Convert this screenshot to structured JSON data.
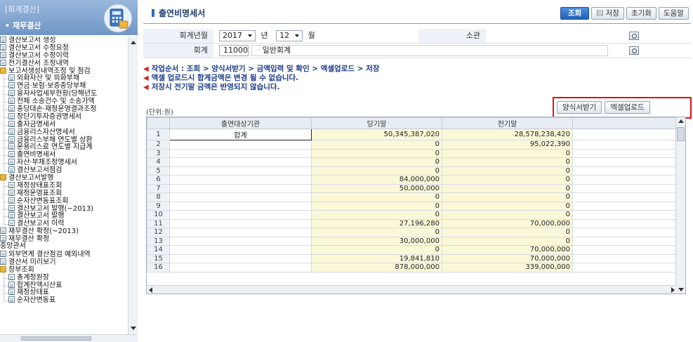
{
  "sidebar": {
    "bracket_title": "[회계결산]",
    "section_title": "재무결산",
    "items": [
      {
        "label": "결산보고서 생성",
        "type": "doc",
        "level": 0
      },
      {
        "label": "결산보고서 수정요청",
        "type": "doc",
        "level": 0
      },
      {
        "label": "결산보고서 수정이력",
        "type": "doc",
        "level": 0
      },
      {
        "label": "전기결산서 조정내역",
        "type": "doc",
        "level": 0
      },
      {
        "label": "보고서생성내역조정 및 점검",
        "type": "folder",
        "level": 0
      },
      {
        "label": "외화자산 및 외화부채",
        "type": "doc",
        "level": 1
      },
      {
        "label": "연금·보험·보증충당부채",
        "type": "doc",
        "level": 1
      },
      {
        "label": "융자사업세부현황(당해년도",
        "type": "doc",
        "level": 1
      },
      {
        "label": "전체 소송건수 및 소송가액",
        "type": "doc",
        "level": 1
      },
      {
        "label": "충당대손·재정운영결과조정",
        "type": "doc",
        "level": 1
      },
      {
        "label": "장단기투자증권명세서",
        "type": "doc",
        "level": 1
      },
      {
        "label": "출자금명세서",
        "type": "doc",
        "level": 1
      },
      {
        "label": "금융리스자산명세서",
        "type": "doc",
        "level": 1
      },
      {
        "label": "금융리스부채 연도별 상환",
        "type": "doc",
        "level": 1
      },
      {
        "label": "운용리스료 연도별 지급계",
        "type": "doc",
        "level": 1
      },
      {
        "label": "출연비명세서",
        "type": "doc",
        "level": 1
      },
      {
        "label": "자산·부채조정명세서",
        "type": "doc",
        "level": 1
      },
      {
        "label": "결산보고서점검",
        "type": "doc",
        "level": 1
      },
      {
        "label": "결산보고서발행",
        "type": "folder",
        "level": 0
      },
      {
        "label": "재정상태표조회",
        "type": "doc",
        "level": 1
      },
      {
        "label": "재정운영표조회",
        "type": "doc",
        "level": 1
      },
      {
        "label": "순자산변동표조회",
        "type": "doc",
        "level": 1
      },
      {
        "label": "결산보고서 발행(~2013)",
        "type": "doc",
        "level": 1
      },
      {
        "label": "결산보고서 발행",
        "type": "doc",
        "level": 1
      },
      {
        "label": "결산보고서 이력",
        "type": "doc",
        "level": 1
      },
      {
        "label": "재무결산 확정(~2013)",
        "type": "doc",
        "level": 0
      },
      {
        "label": "재무결산 확정",
        "type": "doc",
        "level": 0
      },
      {
        "label": "중앙관서",
        "type": "none",
        "level": 0
      },
      {
        "label": "외부연계 결산점검 예외내역",
        "type": "doc",
        "level": 0
      },
      {
        "label": "결산서 미리보기",
        "type": "doc",
        "level": 0
      },
      {
        "label": "장부조회",
        "type": "folder",
        "level": 0
      },
      {
        "label": "총계정원장",
        "type": "doc",
        "level": 1
      },
      {
        "label": "합계잔액시산표",
        "type": "doc",
        "level": 1
      },
      {
        "label": "재정상태표",
        "type": "doc",
        "level": 1
      },
      {
        "label": "순자산변동표",
        "type": "doc",
        "level": 1
      }
    ]
  },
  "header": {
    "page_title": "출연비명세서",
    "buttons": {
      "search": "조회",
      "save": "저장",
      "reset": "초기화",
      "help": "도움말"
    }
  },
  "form": {
    "fiscal_label": "회계년월",
    "year": "2017",
    "year_unit": "년",
    "month": "12",
    "month_unit": "월",
    "office_label": "소관",
    "office_value": "",
    "account_label": "회계",
    "account_code": "11000",
    "account_name": "일반회계"
  },
  "notes": [
    "작업순서 : 조회 > 양식서받기 > 금액입력 및 확인 > 엑셀업로드 > 저장",
    "엑셀 업로드시 합계금액은 변경 될 수 없습니다.",
    "저장시 전기말 금액은 반영되지 않습니다."
  ],
  "unit_label": "(단위:원)",
  "upload_buttons": {
    "template": "양식서받기",
    "excel": "엑셀업로드"
  },
  "grid": {
    "columns": [
      "",
      "출연대상기관",
      "당기말",
      "전기말",
      ""
    ],
    "rows": [
      {
        "no": "1",
        "org": "합계",
        "current": "50,345,387,020",
        "previous": "28,578,238,420"
      },
      {
        "no": "2",
        "org": "",
        "current": "0",
        "previous": "95,022,390"
      },
      {
        "no": "3",
        "org": "",
        "current": "0",
        "previous": "0"
      },
      {
        "no": "4",
        "org": "",
        "current": "0",
        "previous": "0"
      },
      {
        "no": "5",
        "org": "",
        "current": "0",
        "previous": "0"
      },
      {
        "no": "6",
        "org": "",
        "current": "84,000,000",
        "previous": "0"
      },
      {
        "no": "7",
        "org": "",
        "current": "50,000,000",
        "previous": "0"
      },
      {
        "no": "8",
        "org": "",
        "current": "0",
        "previous": "0"
      },
      {
        "no": "9",
        "org": "",
        "current": "0",
        "previous": "0"
      },
      {
        "no": "10",
        "org": "",
        "current": "0",
        "previous": "0"
      },
      {
        "no": "11",
        "org": "",
        "current": "27,196,280",
        "previous": "70,000,000"
      },
      {
        "no": "12",
        "org": "",
        "current": "0",
        "previous": "0"
      },
      {
        "no": "13",
        "org": "",
        "current": "30,000,000",
        "previous": "0"
      },
      {
        "no": "14",
        "org": "",
        "current": "0",
        "previous": "70,000,000"
      },
      {
        "no": "15",
        "org": "",
        "current": "19,841,810",
        "previous": "70,000,000"
      },
      {
        "no": "16",
        "org": "",
        "current": "878,000,000",
        "previous": "339,000,000"
      }
    ]
  },
  "colors": {
    "accent": "#2261b8",
    "note_text": "#1a3b8a",
    "highlight_border": "#e01010",
    "amount_cell": "#fbf8d8"
  }
}
